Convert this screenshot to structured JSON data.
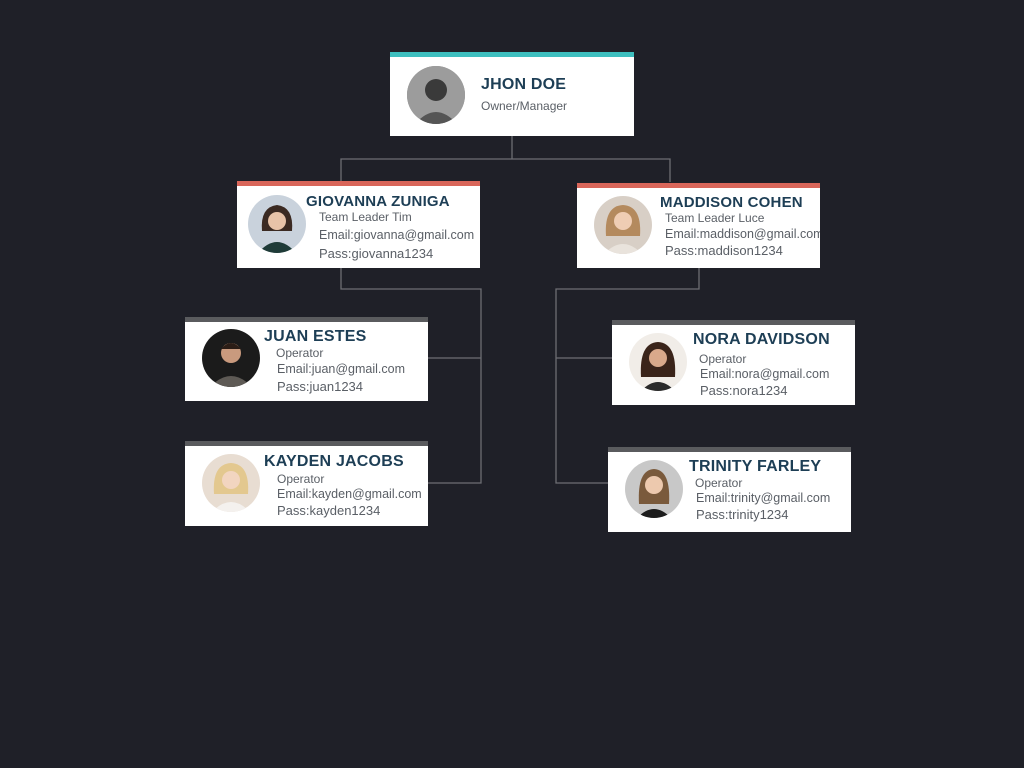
{
  "colors": {
    "background": "#1f2028",
    "connector": "#6d6e73",
    "top_accent": "#3ebfbf",
    "leader_accent": "#d9665a",
    "operator_accent": "#5a5b5e",
    "name_text": "#1d3e55"
  },
  "root": {
    "name": "JHON DOE",
    "role": "Owner/Manager",
    "avatar": "avatar-photo-icon"
  },
  "leaders": [
    {
      "name": "GIOVANNA ZUNIGA",
      "role": "Team Leader Tim",
      "email": "Email:giovanna@gmail.com",
      "pass": "Pass:giovanna1234",
      "avatar": "avatar-photo-icon"
    },
    {
      "name": "MADDISON COHEN",
      "role": "Team Leader Luce",
      "email": "Email:maddison@gmail.com",
      "pass": "Pass:maddison1234",
      "avatar": "avatar-photo-icon"
    }
  ],
  "operators": [
    {
      "name": "JUAN ESTES",
      "role": "Operator",
      "email": "Email:juan@gmail.com",
      "pass": "Pass:juan1234",
      "avatar": "avatar-photo-icon"
    },
    {
      "name": "KAYDEN JACOBS",
      "role": "Operator",
      "email": "Email:kayden@gmail.com",
      "pass": "Pass:kayden1234",
      "avatar": "avatar-photo-icon"
    },
    {
      "name": "NORA DAVIDSON",
      "role": "Operator",
      "email": "Email:nora@gmail.com",
      "pass": "Pass:nora1234",
      "avatar": "avatar-photo-icon"
    },
    {
      "name": "TRINITY FARLEY",
      "role": "Operator",
      "email": "Email:trinity@gmail.com",
      "pass": "Pass:trinity1234",
      "avatar": "avatar-photo-icon"
    }
  ]
}
